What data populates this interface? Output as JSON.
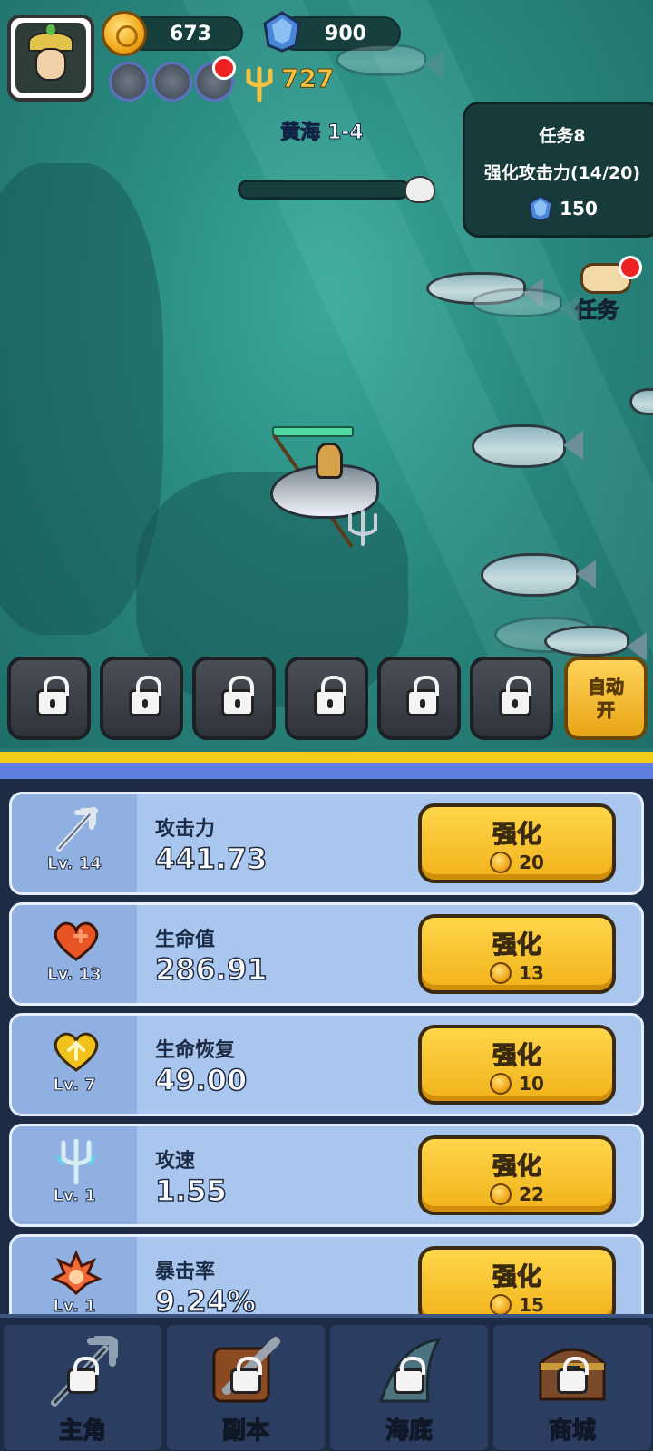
{
  "hud": {
    "coins": "673",
    "gems": "900",
    "trident_power": "727",
    "stage": "黄海 1-4"
  },
  "quest": {
    "title": "任务8",
    "description": "强化攻击力(14/20)",
    "reward": "150",
    "button_label": "任务"
  },
  "skills": {
    "auto_label_line1": "自动",
    "auto_label_line2": "开"
  },
  "upgrades": [
    {
      "icon": "trident-icon",
      "level": "Lv. 14",
      "name": "攻击力",
      "value": "441.73",
      "button": "强化",
      "cost": "20"
    },
    {
      "icon": "heart-plus-icon",
      "level": "Lv. 13",
      "name": "生命值",
      "value": "286.91",
      "button": "强化",
      "cost": "13"
    },
    {
      "icon": "heart-up-icon",
      "level": "Lv. 7",
      "name": "生命恢复",
      "value": "49.00",
      "button": "强化",
      "cost": "10"
    },
    {
      "icon": "lightning-trident-icon",
      "level": "Lv. 1",
      "name": "攻速",
      "value": "1.55",
      "button": "强化",
      "cost": "22"
    },
    {
      "icon": "fire-burst-icon",
      "level": "Lv. 1",
      "name": "暴击率",
      "value": "9.24%",
      "button": "强化",
      "cost": "15"
    }
  ],
  "nav": [
    {
      "label": "主角",
      "icon": "trident-icon"
    },
    {
      "label": "副本",
      "icon": "sword-icon"
    },
    {
      "label": "海底",
      "icon": "shark-fin-icon"
    },
    {
      "label": "商城",
      "icon": "treasure-chest-icon"
    }
  ],
  "colors": {
    "sea": "#2a8a80",
    "button_yellow": "#f1b21a",
    "card_blue": "#a8c6ee",
    "panel_dark": "#1d2b45"
  }
}
